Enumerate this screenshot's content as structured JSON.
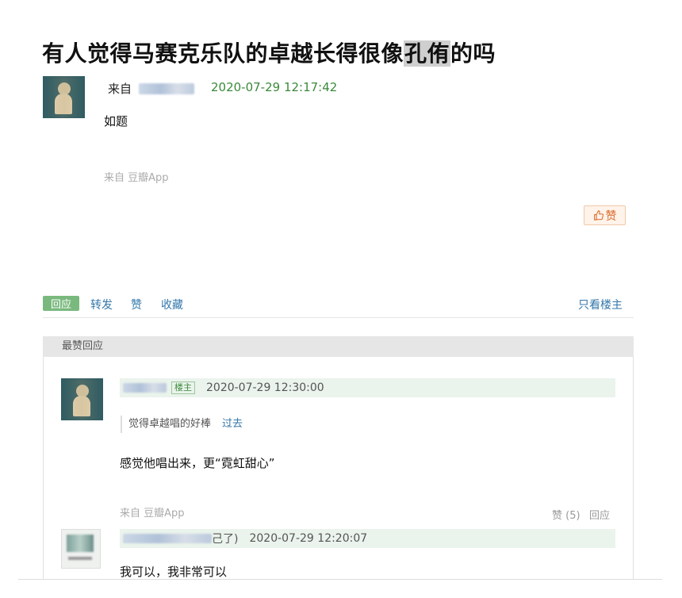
{
  "post": {
    "title_before": "有人觉得马赛克乐队的卓越长得很像",
    "title_highlight": "孔侑",
    "title_after": "的吗",
    "from_label": "来自",
    "timestamp": "2020-07-29 12:17:42",
    "content": "如题",
    "source": "来自 豆瓣App",
    "like_label": "赞"
  },
  "action_bar": {
    "reply": "回应",
    "forward": "转发",
    "like": "赞",
    "collect": "收藏",
    "only_owner": "只看楼主"
  },
  "top_replies": {
    "header": "最赞回应",
    "items": [
      {
        "owner_tag": "楼主",
        "timestamp": "2020-07-29 12:30:00",
        "quote_text": "觉得卓越唱的好棒",
        "quote_more": "过去",
        "content": "感觉他唱出来，更“霓虹甜心”",
        "source": "来自 豆瓣App",
        "like": "赞 (5)",
        "reply": "回应"
      },
      {
        "name_tail": "己了)",
        "timestamp": "2020-07-29 12:20:07",
        "content": "我可以，我非常可以"
      }
    ]
  },
  "colors": {
    "time_green": "#3a8a3a",
    "link_blue": "#3377aa",
    "reply_tag_green": "#7ab97e",
    "like_orange": "#d96a2a"
  }
}
